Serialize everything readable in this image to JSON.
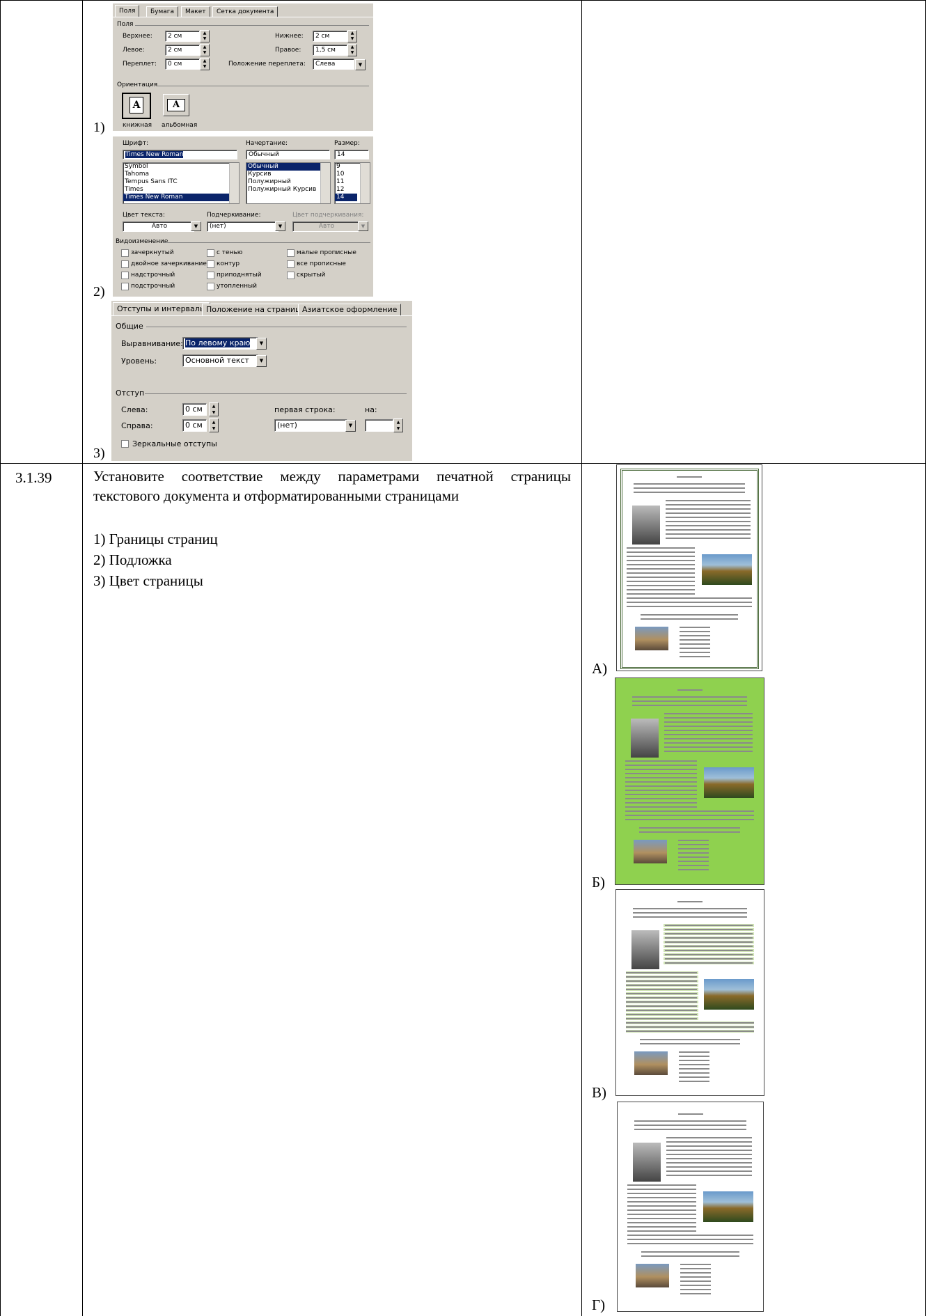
{
  "dialogs": {
    "page_setup": {
      "tabs": [
        "Поля",
        "Бумага",
        "Макет",
        "Сетка документа"
      ],
      "group_title": "Поля",
      "labels": {
        "top": "Верхнее:",
        "bottom": "Нижнее:",
        "left": "Левое:",
        "right": "Правое:",
        "gutter": "Переплет:",
        "gutter_pos": "Положение переплета:"
      },
      "values": {
        "top": "2 см",
        "bottom": "2 см",
        "left": "2 см",
        "right": "1,5 см",
        "gutter": "0 см",
        "gutter_pos": "Слева"
      },
      "orientation_title": "Ориентация",
      "portrait": "книжная",
      "landscape": "альбомная",
      "marker": "1)"
    },
    "font": {
      "font_label": "Шрифт:",
      "style_label": "Начертание:",
      "size_label": "Размер:",
      "font_value": "Times New Roman",
      "style_value": "Обычный",
      "size_value": "14",
      "font_list": [
        "Symbol",
        "Tahoma",
        "Tempus Sans ITC",
        "Times",
        "Times New Roman"
      ],
      "style_list": [
        "Обычный",
        "Курсив",
        "Полужирный",
        "Полужирный Курсив"
      ],
      "size_list": [
        "9",
        "10",
        "11",
        "12",
        "14"
      ],
      "color_label": "Цвет текста:",
      "underline_label": "Подчеркивание:",
      "underline_color_label": "Цвет подчеркивания:",
      "color_value": "Авто",
      "underline_value": "(нет)",
      "underline_color_value": "Авто",
      "effects_title": "Видоизменение",
      "effects": [
        "зачеркнутый",
        "с тенью",
        "малые прописные",
        "двойное зачеркивание",
        "контур",
        "все прописные",
        "надстрочный",
        "приподнятый",
        "скрытый",
        "подстрочный",
        "утопленный"
      ],
      "marker": "2)"
    },
    "paragraph": {
      "tabs": [
        "Отступы и интервалы",
        "Положение на странице",
        "Азиатское оформление"
      ],
      "general_title": "Общие",
      "align_label": "Выравнивание:",
      "align_value": "По левому краю",
      "level_label": "Уровень:",
      "level_value": "Основной текст",
      "indent_title": "Отступ",
      "left_label": "Слева:",
      "left_value": "0 см",
      "right_label": "Справа:",
      "right_value": "0 см",
      "first_line_label": "первая строка:",
      "first_line_value": "(нет)",
      "by_label": "на:",
      "mirror_label": "Зеркальные отступы",
      "marker": "3)"
    }
  },
  "task": {
    "number": "3.1.39",
    "text": "Установите соответствие между параметрами печатной страницы текстового документа и отформатированными страницами",
    "items": [
      "1) Границы страниц",
      "2) Подложка",
      "3) Цвет страницы"
    ]
  },
  "answers": [
    {
      "label": "А)",
      "background": "#ffffff",
      "border": "#4a6a3a"
    },
    {
      "label": "Б)",
      "background": "#8fd14f",
      "border": "#555555"
    },
    {
      "label": "В)",
      "background": "#ffffff",
      "border": "#555555"
    },
    {
      "label": "Г)",
      "background": "#ffffff",
      "border": "#555555"
    }
  ],
  "colors": {
    "dialog_bg": "#d4d0c8",
    "selection": "#0a246a",
    "green_page": "#8fd14f",
    "highlight": "#cfe3b4"
  }
}
